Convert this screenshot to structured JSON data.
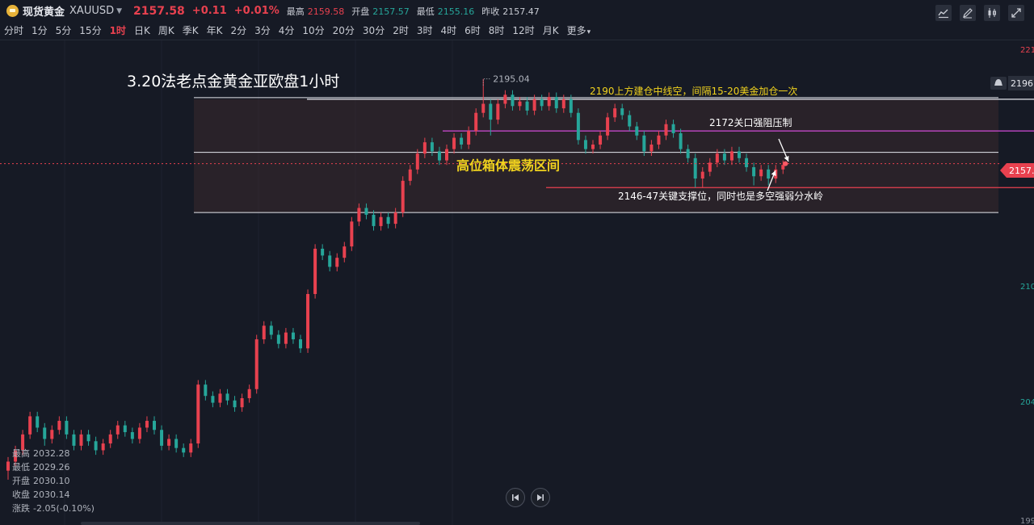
{
  "header": {
    "symbol_name": "现货黄金",
    "symbol_code": "XAUUSD",
    "price": "2157.58",
    "change": "+0.11",
    "change_pct": "+0.01%",
    "stats": [
      {
        "label": "最高",
        "value": "2159.58",
        "tone": "up"
      },
      {
        "label": "开盘",
        "value": "2157.57",
        "tone": "dn"
      },
      {
        "label": "最低",
        "value": "2155.16",
        "tone": "dn"
      },
      {
        "label": "昨收",
        "value": "2157.47",
        "tone": "nu"
      }
    ]
  },
  "timeframes": [
    "分时",
    "1分",
    "5分",
    "15分",
    "1时",
    "日K",
    "周K",
    "季K",
    "年K",
    "2分",
    "3分",
    "4分",
    "10分",
    "20分",
    "30分",
    "2时",
    "3时",
    "4时",
    "6时",
    "8时",
    "12时",
    "月K",
    "更多"
  ],
  "active_timeframe": "1时",
  "toolbar_icons": [
    "indicator-icon",
    "draw-icon",
    "candle-style-icon",
    "fullscreen-icon"
  ],
  "colors": {
    "up": "#e8414f",
    "down": "#26a69a",
    "background": "#161a25",
    "accent_yellow": "#f0d21e",
    "magenta": "#d04bd6"
  },
  "chart_data": {
    "type": "candlestick",
    "symbol": "XAUUSD",
    "title": "3.20法老点金黄金亚欧盘1小时",
    "ylim": [
      1998,
      2212
    ],
    "y_axis_labels": [
      "221",
      "2196.",
      "2157.",
      "210",
      "204",
      "199"
    ],
    "candles": [
      [
        2022,
        2026,
        2018,
        2028
      ],
      [
        2026,
        2031,
        2024,
        2033
      ],
      [
        2031,
        2038,
        2029,
        2040
      ],
      [
        2038,
        2046,
        2036,
        2048
      ],
      [
        2046,
        2041,
        2039,
        2048
      ],
      [
        2041,
        2036,
        2033,
        2043
      ],
      [
        2036,
        2040,
        2034,
        2042
      ],
      [
        2040,
        2044,
        2038,
        2046
      ],
      [
        2044,
        2038,
        2036,
        2046
      ],
      [
        2038,
        2033,
        2031,
        2040
      ],
      [
        2033,
        2038,
        2031,
        2040
      ],
      [
        2038,
        2035,
        2033,
        2040
      ],
      [
        2035,
        2031,
        2029,
        2037
      ],
      [
        2031,
        2034,
        2029,
        2036
      ],
      [
        2034,
        2038,
        2032,
        2040
      ],
      [
        2038,
        2042,
        2036,
        2044
      ],
      [
        2042,
        2039,
        2037,
        2044
      ],
      [
        2039,
        2036,
        2034,
        2041
      ],
      [
        2036,
        2041,
        2034,
        2043
      ],
      [
        2041,
        2044,
        2039,
        2046
      ],
      [
        2044,
        2040,
        2038,
        2046
      ],
      [
        2040,
        2033,
        2031,
        2042
      ],
      [
        2033,
        2036,
        2031,
        2038
      ],
      [
        2036,
        2032,
        2030,
        2038
      ],
      [
        2032,
        2030,
        2028,
        2034
      ],
      [
        2030,
        2034,
        2028,
        2036
      ],
      [
        2034,
        2060,
        2032,
        2062
      ],
      [
        2060,
        2055,
        2053,
        2062
      ],
      [
        2055,
        2052,
        2050,
        2057
      ],
      [
        2052,
        2056,
        2050,
        2058
      ],
      [
        2056,
        2053,
        2051,
        2058
      ],
      [
        2053,
        2050,
        2048,
        2055
      ],
      [
        2050,
        2054,
        2048,
        2056
      ],
      [
        2054,
        2058,
        2052,
        2060
      ],
      [
        2058,
        2080,
        2056,
        2082
      ],
      [
        2080,
        2086,
        2078,
        2088
      ],
      [
        2086,
        2082,
        2080,
        2088
      ],
      [
        2082,
        2078,
        2076,
        2084
      ],
      [
        2078,
        2083,
        2076,
        2085
      ],
      [
        2083,
        2080,
        2078,
        2085
      ],
      [
        2080,
        2076,
        2074,
        2082
      ],
      [
        2076,
        2100,
        2074,
        2102
      ],
      [
        2100,
        2120,
        2098,
        2122
      ],
      [
        2120,
        2117,
        2115,
        2122
      ],
      [
        2117,
        2112,
        2110,
        2119
      ],
      [
        2112,
        2116,
        2110,
        2118
      ],
      [
        2116,
        2121,
        2114,
        2123
      ],
      [
        2121,
        2132,
        2119,
        2134
      ],
      [
        2132,
        2138,
        2130,
        2140
      ],
      [
        2138,
        2135,
        2133,
        2140
      ],
      [
        2135,
        2130,
        2128,
        2137
      ],
      [
        2130,
        2134,
        2128,
        2136
      ],
      [
        2134,
        2131,
        2129,
        2136
      ],
      [
        2131,
        2136,
        2129,
        2138
      ],
      [
        2136,
        2150,
        2134,
        2152
      ],
      [
        2150,
        2155,
        2148,
        2157
      ],
      [
        2155,
        2162,
        2153,
        2164
      ],
      [
        2162,
        2167,
        2160,
        2169
      ],
      [
        2167,
        2163,
        2161,
        2169
      ],
      [
        2163,
        2159,
        2157,
        2165
      ],
      [
        2159,
        2164,
        2157,
        2166
      ],
      [
        2164,
        2169,
        2162,
        2171
      ],
      [
        2169,
        2166,
        2164,
        2171
      ],
      [
        2166,
        2172,
        2164,
        2174
      ],
      [
        2172,
        2180,
        2170,
        2182
      ],
      [
        2180,
        2184,
        2178,
        2195
      ],
      [
        2184,
        2177,
        2170,
        2186
      ],
      [
        2177,
        2184,
        2175,
        2186
      ],
      [
        2184,
        2188,
        2182,
        2190
      ],
      [
        2188,
        2183,
        2181,
        2190
      ],
      [
        2183,
        2185,
        2181,
        2187
      ],
      [
        2185,
        2181,
        2179,
        2187
      ],
      [
        2181,
        2186,
        2179,
        2188
      ],
      [
        2186,
        2183,
        2181,
        2188
      ],
      [
        2183,
        2187,
        2181,
        2189
      ],
      [
        2187,
        2182,
        2180,
        2189
      ],
      [
        2182,
        2186,
        2180,
        2188
      ],
      [
        2186,
        2180,
        2178,
        2188
      ],
      [
        2180,
        2168,
        2166,
        2182
      ],
      [
        2168,
        2164,
        2162,
        2170
      ],
      [
        2164,
        2166,
        2162,
        2168
      ],
      [
        2166,
        2170,
        2164,
        2172
      ],
      [
        2170,
        2178,
        2168,
        2180
      ],
      [
        2178,
        2182,
        2176,
        2184
      ],
      [
        2182,
        2179,
        2177,
        2184
      ],
      [
        2179,
        2174,
        2172,
        2181
      ],
      [
        2174,
        2170,
        2168,
        2176
      ],
      [
        2170,
        2163,
        2161,
        2172
      ],
      [
        2163,
        2166,
        2161,
        2168
      ],
      [
        2166,
        2170,
        2164,
        2172
      ],
      [
        2170,
        2175,
        2168,
        2177
      ],
      [
        2175,
        2171,
        2169,
        2177
      ],
      [
        2171,
        2164,
        2162,
        2173
      ],
      [
        2164,
        2160,
        2158,
        2166
      ],
      [
        2160,
        2151,
        2147,
        2162
      ],
      [
        2151,
        2154,
        2147,
        2156
      ],
      [
        2154,
        2158,
        2152,
        2160
      ],
      [
        2158,
        2162,
        2156,
        2164
      ],
      [
        2162,
        2159,
        2157,
        2164
      ],
      [
        2159,
        2163,
        2157,
        2165
      ],
      [
        2163,
        2160,
        2158,
        2165
      ],
      [
        2160,
        2156,
        2154,
        2162
      ],
      [
        2156,
        2152,
        2148,
        2158
      ],
      [
        2152,
        2155,
        2150,
        2157
      ],
      [
        2155,
        2151,
        2148,
        2157
      ],
      [
        2151,
        2155,
        2149,
        2157
      ],
      [
        2155,
        2157,
        2153,
        2159
      ]
    ],
    "horizontal_levels": [
      2195,
      2186,
      2172,
      2159,
      2147,
      2136
    ],
    "text_annotations": {
      "high_marker": "2195.04",
      "short_plan": "2190上方建仓中线空，间隔15-20美金加仓一次",
      "resistance": "2172关口强阻压制",
      "box_label": "高位箱体震荡区间",
      "support": "2146-47关键支撑位，同时也是多空强弱分水岭"
    },
    "current_price": 2157.58
  },
  "ohlc_box": {
    "items": [
      {
        "label": "最高",
        "value": "2032.28"
      },
      {
        "label": "最低",
        "value": "2029.26"
      },
      {
        "label": "开盘",
        "value": "2030.10"
      },
      {
        "label": "收盘",
        "value": "2030.14"
      },
      {
        "label": "涨跌",
        "value": "-2.05(-0.10%)"
      }
    ]
  }
}
